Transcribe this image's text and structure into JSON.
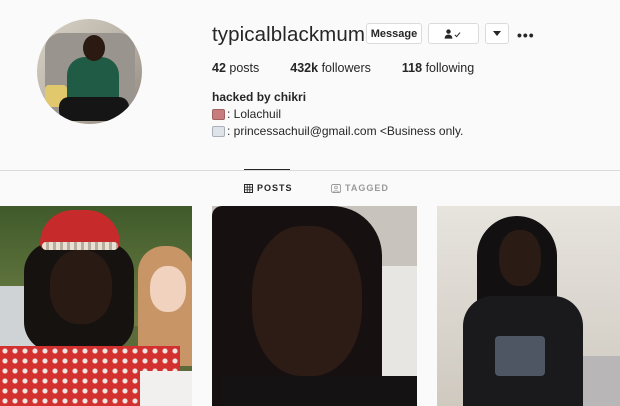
{
  "profile": {
    "username": "typicalblackmum",
    "message_label": "Message",
    "follow_icon": "person-check-icon",
    "dropdown_icon": "caret-down-icon",
    "more_icon": "ellipsis-icon",
    "more_text": "•••",
    "stats": [
      {
        "value": "42",
        "label": "posts"
      },
      {
        "value": "432k",
        "label": "followers"
      },
      {
        "value": "118",
        "label": "following"
      }
    ],
    "full_name": "hacked by chikri",
    "bio_lines": [
      {
        "emoji": "crab-emoji-icon",
        "text": ": Lolachuil"
      },
      {
        "emoji": "envelope-emoji-icon",
        "text": ": princessachuil@gmail.com <Business only."
      }
    ]
  },
  "tabs": [
    {
      "label": "POSTS",
      "icon": "grid-icon",
      "active": true
    },
    {
      "label": "TAGGED",
      "icon": "tag-person-icon",
      "active": false
    }
  ],
  "colors": {
    "background": "#fafafa",
    "text": "#262626",
    "muted": "#999999",
    "border": "#dbdbdb"
  }
}
